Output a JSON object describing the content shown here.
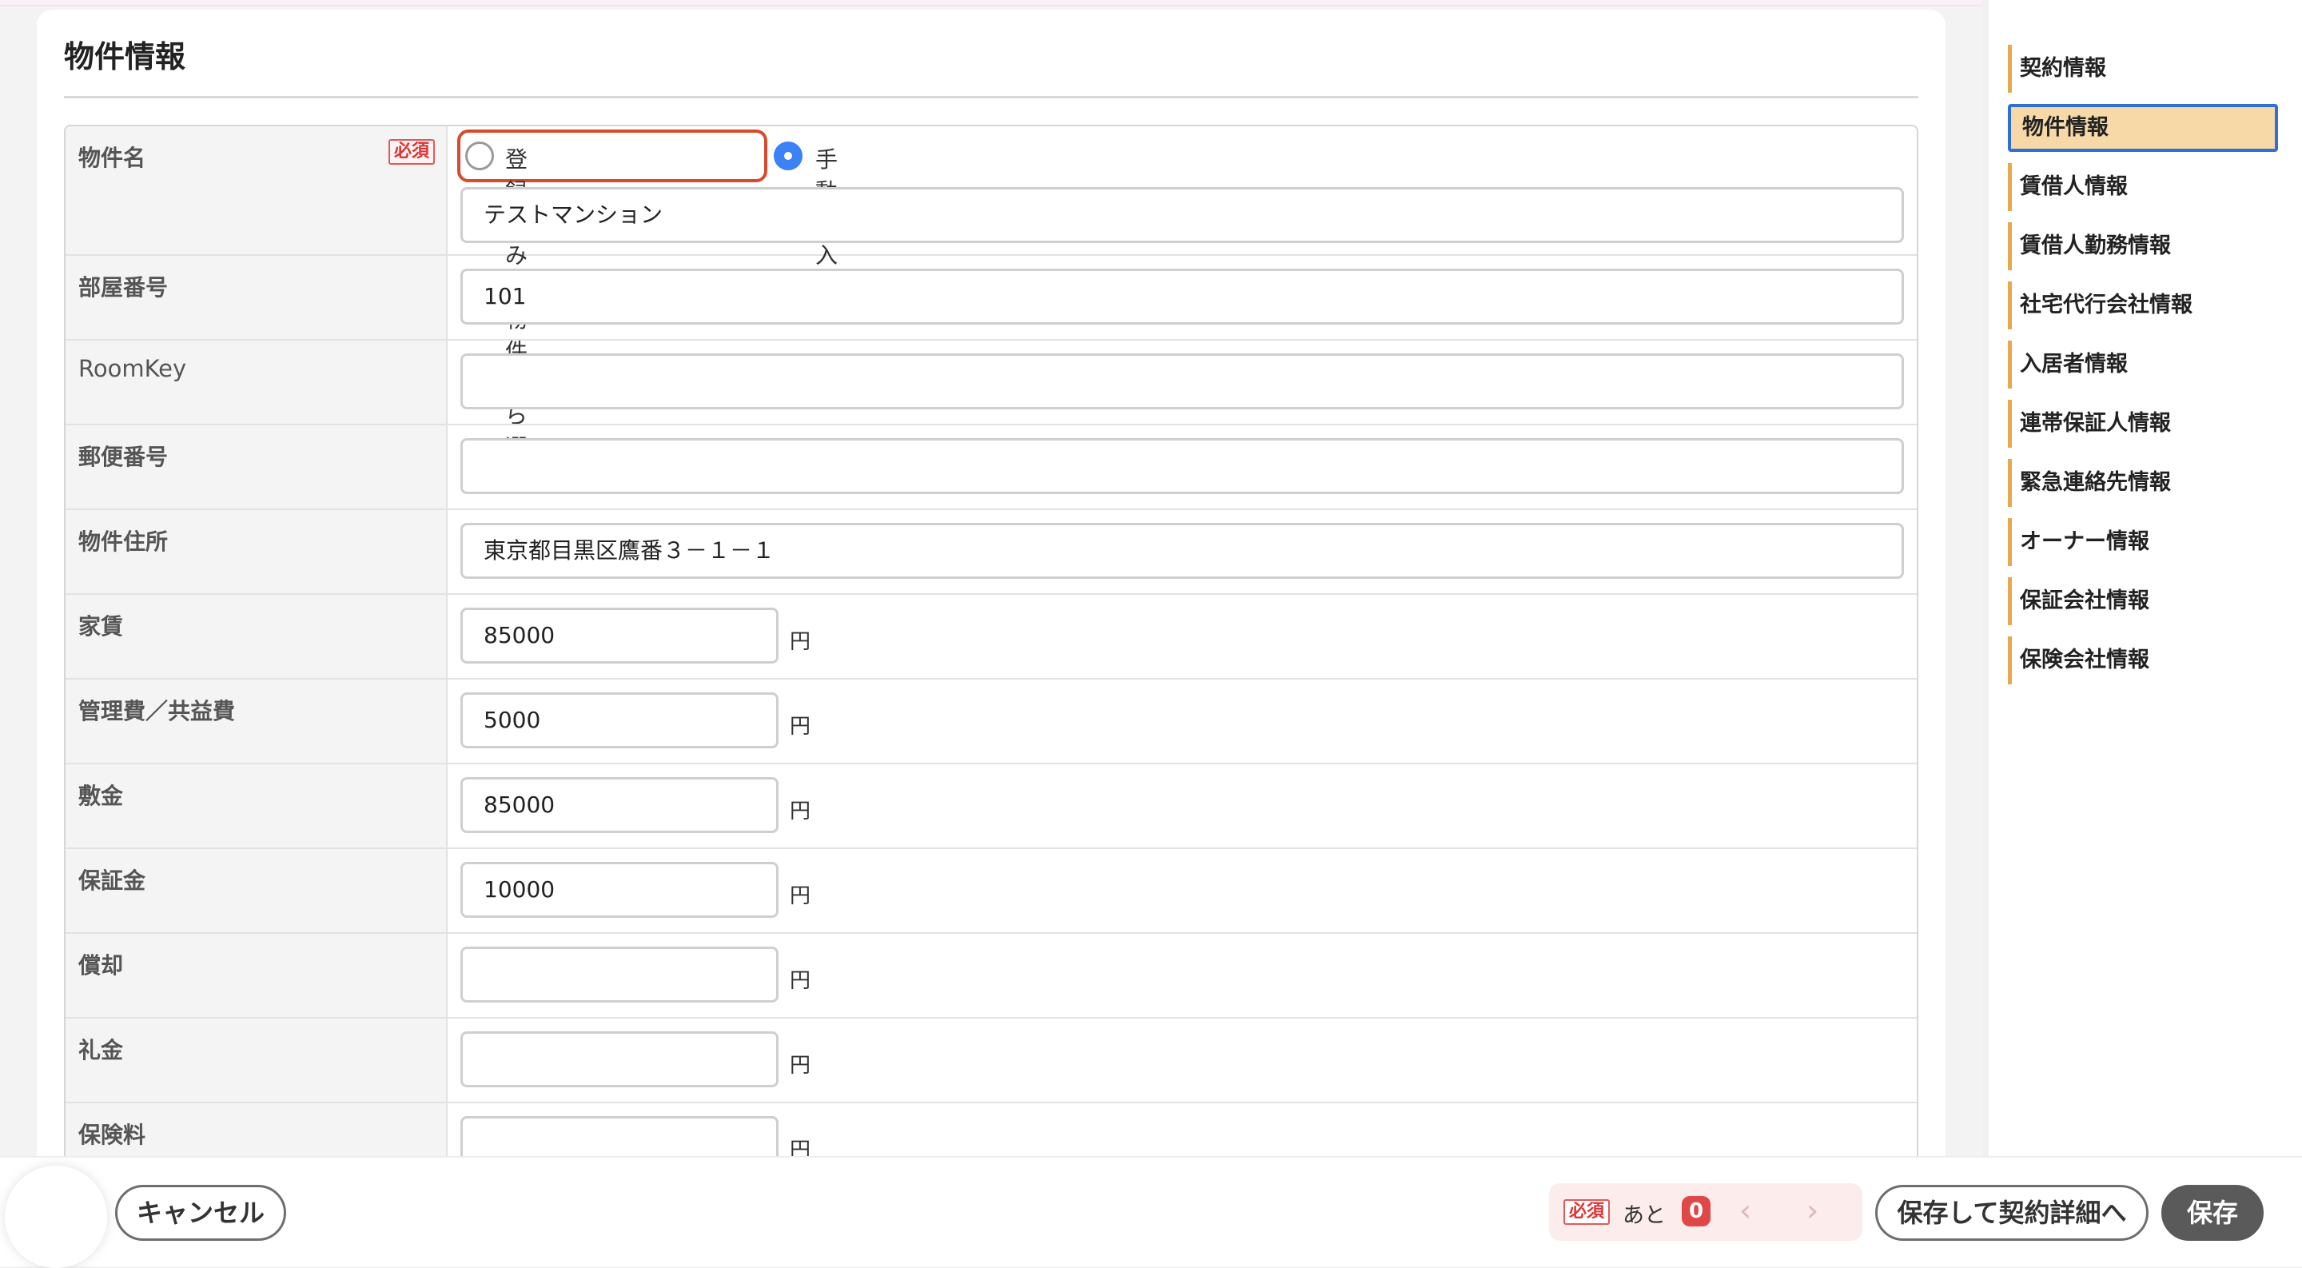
{
  "section": {
    "title": "物件情報"
  },
  "required_badge": "必須",
  "property_name": {
    "label": "物件名",
    "radio_registered": "登録済みの物件から選択",
    "radio_manual": "手動で入力",
    "value": "テストマンション"
  },
  "fields": {
    "room_number": {
      "label": "部屋番号",
      "value": "101"
    },
    "room_key": {
      "label": "RoomKey",
      "value": ""
    },
    "postal_code": {
      "label": "郵便番号",
      "value": ""
    },
    "address": {
      "label": "物件住所",
      "value": "東京都目黒区鷹番３－１－１"
    },
    "rent": {
      "label": "家賃",
      "value": "85000",
      "unit": "円"
    },
    "management_fee": {
      "label": "管理費／共益費",
      "value": "5000",
      "unit": "円"
    },
    "deposit": {
      "label": "敷金",
      "value": "85000",
      "unit": "円"
    },
    "guarantee_money": {
      "label": "保証金",
      "value": "10000",
      "unit": "円"
    },
    "amortization": {
      "label": "償却",
      "value": "",
      "unit": "円"
    },
    "key_money": {
      "label": "礼金",
      "value": "",
      "unit": "円"
    },
    "insurance_fee": {
      "label": "保険料",
      "value": "",
      "unit": "円"
    }
  },
  "sidebar": {
    "items": [
      {
        "label": "契約情報",
        "active": false
      },
      {
        "label": "物件情報",
        "active": true
      },
      {
        "label": "賃借人情報",
        "active": false
      },
      {
        "label": "賃借人勤務情報",
        "active": false
      },
      {
        "label": "社宅代行会社情報",
        "active": false
      },
      {
        "label": "入居者情報",
        "active": false
      },
      {
        "label": "連帯保証人情報",
        "active": false
      },
      {
        "label": "緊急連絡先情報",
        "active": false
      },
      {
        "label": "オーナー情報",
        "active": false
      },
      {
        "label": "保証会社情報",
        "active": false
      },
      {
        "label": "保険会社情報",
        "active": false
      }
    ]
  },
  "footer": {
    "cancel_label": "キャンセル",
    "required_tag": "必須",
    "remaining_label": "あと",
    "remaining_count": "0",
    "save_and_detail_label": "保存して契約詳細へ",
    "save_label": "保存"
  },
  "colors": {
    "accent_orange": "#e8a94e",
    "active_nav_bg": "#f7d9a8",
    "active_nav_border": "#2f6fd6",
    "radio_blue": "#3b82f6",
    "highlight_red": "#d74a2c",
    "required_red": "#e04848"
  }
}
